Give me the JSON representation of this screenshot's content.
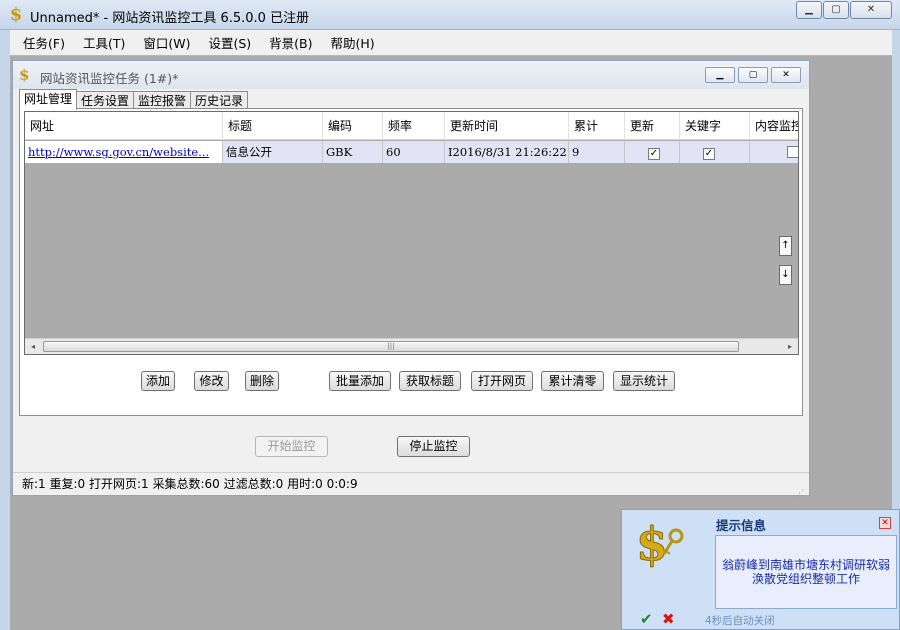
{
  "window": {
    "title": "Unnamed* - 网站资讯监控工具 6.5.0.0  已注册",
    "icon": "dollar-icon",
    "minimize": "▁",
    "maximize": "▢",
    "close": "✕"
  },
  "menu": [
    "任务(F)",
    "工具(T)",
    "窗口(W)",
    "设置(S)",
    "背景(B)",
    "帮助(H)"
  ],
  "child": {
    "title": "网站资讯监控任务  (1#)*",
    "minimize": "▁",
    "maximize": "▢",
    "close": "✕"
  },
  "tabs": [
    "网址管理",
    "任务设置",
    "监控报警",
    "历史记录"
  ],
  "grid": {
    "headers": [
      "网址",
      "标题",
      "编码",
      "频率",
      "更新时间",
      "累计",
      "更新",
      "关键字",
      "内容监控"
    ],
    "rows": [
      {
        "url": "http://www.sg.gov.cn/website...",
        "title": "信息公开",
        "encoding": "GBK",
        "frequency": "60",
        "updated": "I2016/8/31  21:26:22",
        "count": "9",
        "update_checked": "✓",
        "keyword_checked": "✓",
        "content_checked": ""
      }
    ],
    "scroll_up": "↑",
    "scroll_down": "↓",
    "hscroll_left": "◂",
    "hscroll_right": "▸",
    "hscroll_grip": "|||"
  },
  "buttons": {
    "add": "添加",
    "edit": "修改",
    "delete": "删除",
    "batch_add": "批量添加",
    "get_title": "获取标题",
    "open_page": "打开网页",
    "clear_count": "累计清零",
    "show_stats": "显示统计",
    "start": "开始监控",
    "stop": "停止监控"
  },
  "status": "新:1  重复:0  打开网页:1  采集总数:60  过滤总数:0  用时:0 0:0:9",
  "popup": {
    "title": "提示信息",
    "close": "✕",
    "message_line1": "翁蔚峰到南雄市塘东村调研软弱",
    "message_line2": "涣散党组织整顿工作",
    "ok": "✔",
    "cancel": "✖",
    "footer": "4秒后自动关闭",
    "icon": "dollar-key-icon"
  }
}
